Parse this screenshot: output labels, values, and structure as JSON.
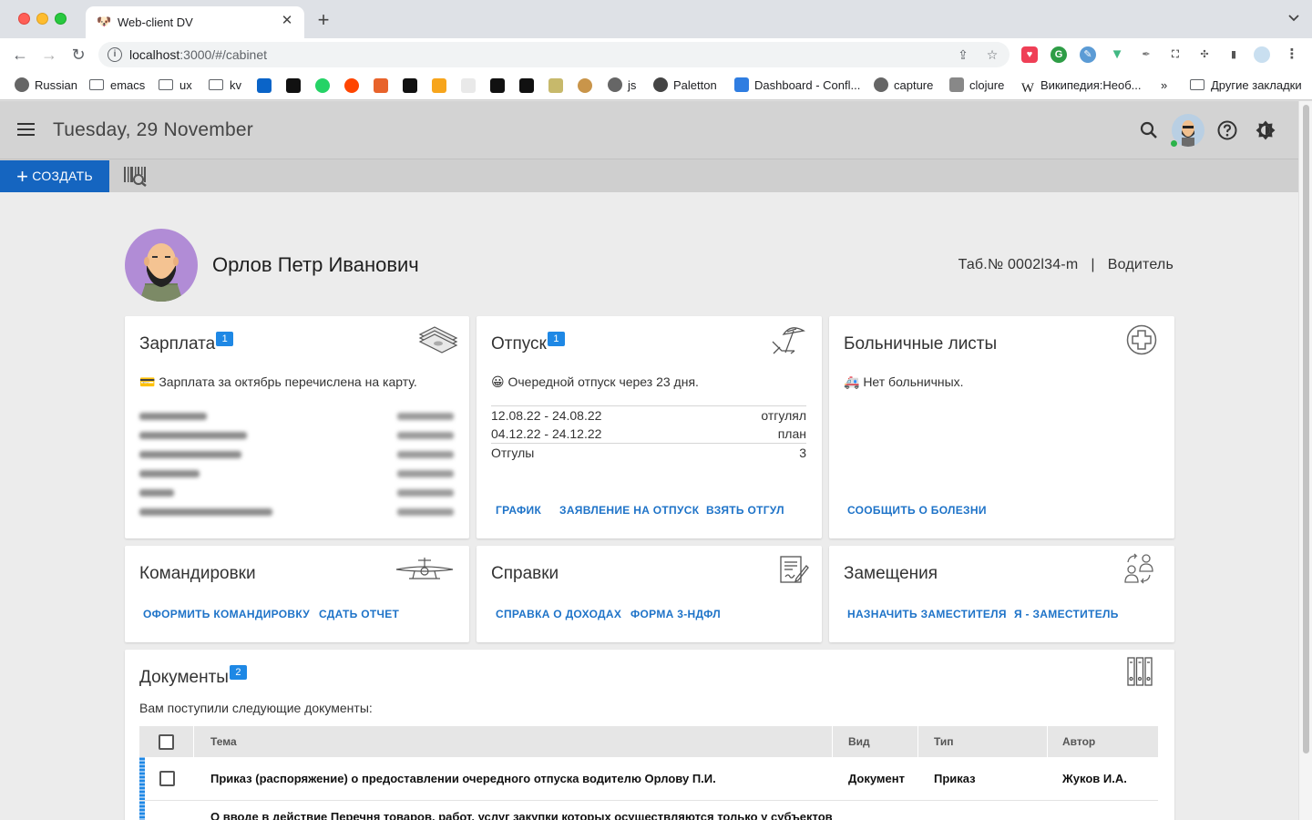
{
  "browser": {
    "tab_title": "Web-client DV",
    "url_host": "localhost",
    "url_rest": ":3000/#/cabinet",
    "bookmarks": [
      {
        "label": "Russian"
      },
      {
        "label": "emacs"
      },
      {
        "label": "ux"
      },
      {
        "label": "kv"
      },
      {
        "label": "js"
      },
      {
        "label": "Paletton"
      },
      {
        "label": "Dashboard - Confl..."
      },
      {
        "label": "capture"
      },
      {
        "label": "clojure"
      },
      {
        "label": "Википедия:Необ..."
      },
      {
        "label": "»"
      },
      {
        "label": "Другие закладки"
      }
    ]
  },
  "appbar": {
    "date": "Tuesday, 29 November",
    "create_label": "СОЗДАТЬ"
  },
  "profile": {
    "name": "Орлов Петр Иванович",
    "tab_number": "Таб.№ 0002l34-m",
    "separator": "|",
    "position": "Водитель"
  },
  "salary": {
    "title": "Зарплата",
    "badge": "1",
    "notice": "💳 Зарплата за октябрь перечислена на карту.",
    "blurred_rows": 6
  },
  "vacation": {
    "title": "Отпуск",
    "badge": "1",
    "notice": "😀 Очередной отпуск через 23 дня.",
    "rows": [
      {
        "period": "12.08.22 - 24.08.22",
        "status": "отгулял"
      },
      {
        "period": "04.12.22 - 24.12.22",
        "status": "план"
      },
      {
        "period": "Отгулы",
        "status": "3"
      }
    ],
    "actions": [
      "ГРАФИК",
      "ЗАЯВЛЕНИЕ НА ОТПУСК",
      "ВЗЯТЬ ОТГУЛ"
    ]
  },
  "sick": {
    "title": "Больничные листы",
    "notice": "🚑 Нет больничных.",
    "actions": [
      "СООБЩИТЬ О БОЛЕЗНИ"
    ]
  },
  "trips": {
    "title": "Командировки",
    "actions": [
      "ОФОРМИТЬ КОМАНДИРОВКУ",
      "СДАТЬ ОТЧЕТ"
    ]
  },
  "certificates": {
    "title": "Справки",
    "actions": [
      "СПРАВКА О ДОХОДАХ",
      "ФОРМА 3-НДФЛ"
    ]
  },
  "substitutions": {
    "title": "Замещения",
    "actions": [
      "НАЗНАЧИТЬ ЗАМЕСТИТЕЛЯ",
      "Я - ЗАМЕСТИТЕЛЬ"
    ]
  },
  "documents": {
    "title": "Документы",
    "badge": "2",
    "subtitle": "Вам поступили следующие документы:",
    "columns": [
      "Тема",
      "Вид",
      "Тип",
      "Автор"
    ],
    "rows": [
      {
        "subject": "Приказ (распоряжение) о предоставлении очередного отпуска водителю Орлову П.И.",
        "kind": "Документ",
        "type": "Приказ",
        "author": "Жуков И.А."
      },
      {
        "subject": "О вводе в действие Перечня товаров, работ, услуг закупки которых осуществляются только у субъектов",
        "kind": "",
        "type": "",
        "author": ""
      }
    ]
  },
  "colors": {
    "primary": "#1565c0",
    "link": "#1e73c8",
    "badge": "#1e88e5",
    "online": "#2bb34a"
  }
}
